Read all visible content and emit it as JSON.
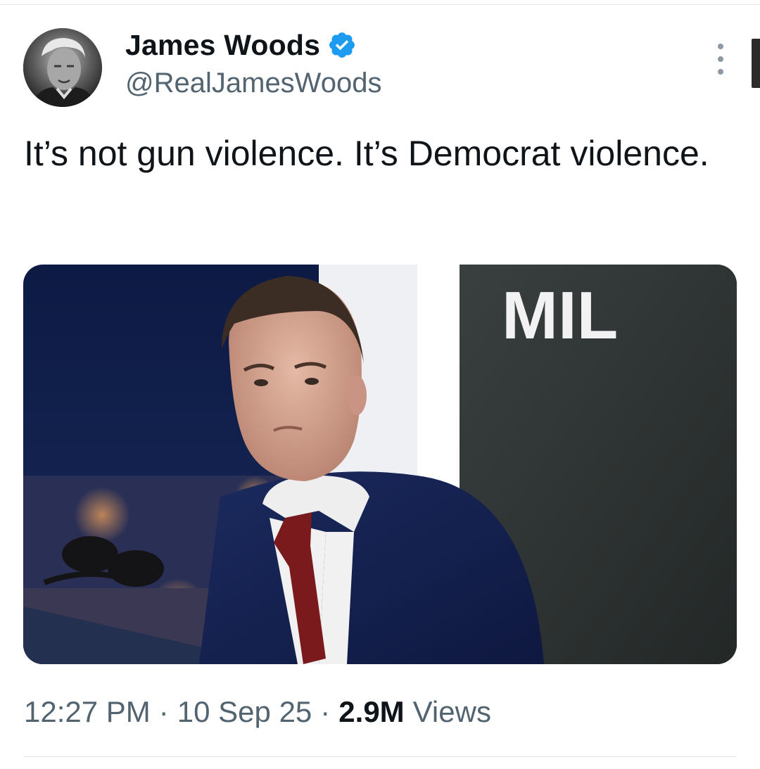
{
  "author": {
    "display_name": "James Woods",
    "handle": "@RealJamesWoods",
    "verified_icon": "verified-badge-icon",
    "verified_color": "#1d9bf0"
  },
  "tweet": {
    "text": "It’s not gun violence. It’s Democrat violence.",
    "time": "12:27 PM",
    "separator_1": "·",
    "date": "10 Sep 25",
    "separator_2": "·",
    "views_count": "2.9M",
    "views_label": "Views"
  },
  "media": {
    "sign_text": "MIL"
  },
  "icons": {
    "more": "more-options-icon"
  },
  "colors": {
    "text_primary": "#0f1419",
    "text_secondary": "#536471"
  }
}
